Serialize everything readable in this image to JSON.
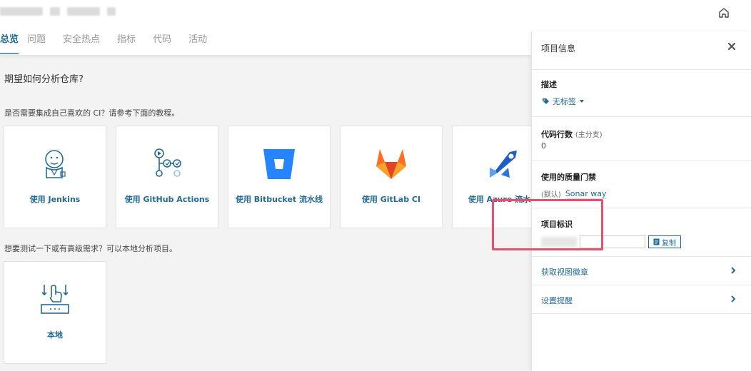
{
  "header": {
    "tabs": [
      {
        "label": "总览"
      },
      {
        "label": "问题"
      },
      {
        "label": "安全热点"
      },
      {
        "label": "指标"
      },
      {
        "label": "代码"
      },
      {
        "label": "活动"
      }
    ]
  },
  "main": {
    "question": "期望如何分析仓库?",
    "ci_prompt": "是否需要集成自己喜欢的 CI？请参考下面的教程。",
    "cards": [
      {
        "label": "使用 Jenkins",
        "icon": "jenkins-icon"
      },
      {
        "label": "使用 GitHub Actions",
        "icon": "github-actions-icon"
      },
      {
        "label": "使用 Bitbucket 流水线",
        "icon": "bitbucket-icon"
      },
      {
        "label": "使用 GitLab CI",
        "icon": "gitlab-icon"
      },
      {
        "label": "使用 Azure 流水线",
        "icon": "azure-icon"
      }
    ],
    "local_prompt": "想要测试一下或有高级需求？可以本地分析项目。",
    "local_card": {
      "label": "本地",
      "icon": "local-icon"
    }
  },
  "panel": {
    "title": "项目信息",
    "description": {
      "title": "描述",
      "tag_label": "无标签"
    },
    "lines": {
      "title": "代码行数",
      "subtitle": "(主分支)",
      "value": "0"
    },
    "quality_gate": {
      "title": "使用的质量门禁",
      "default_label": "(默认)",
      "gate_name": "Sonar way"
    },
    "project_key": {
      "title": "项目标识",
      "copy_label": "复制",
      "key_value": ""
    },
    "links": [
      {
        "label": "获取视图徽章"
      },
      {
        "label": "设置提醒"
      }
    ]
  },
  "colors": {
    "accent": "#236a97",
    "tab_underline": "#4b9fd5",
    "highlight": "#e94e6b"
  }
}
